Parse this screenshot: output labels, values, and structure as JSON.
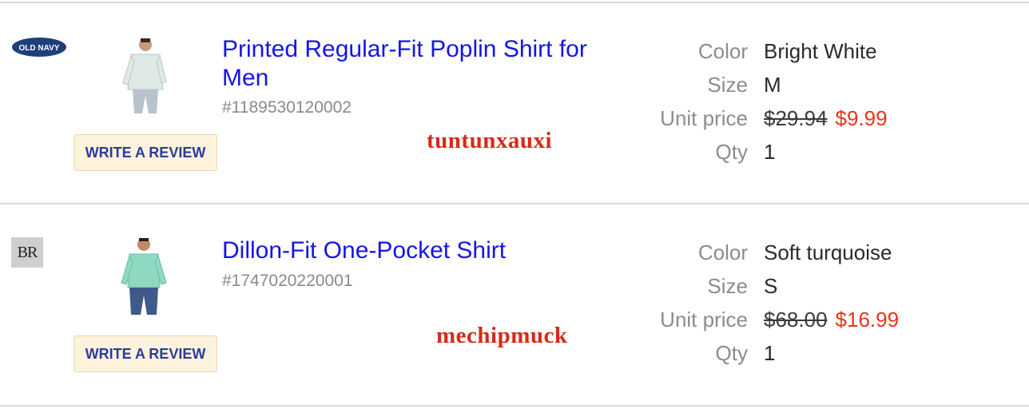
{
  "items": [
    {
      "brand": {
        "name": "OLD NAVY",
        "logo_text": "OLD NAVY",
        "icon": "old-navy-logo"
      },
      "title": "Printed Regular-Fit Poplin Shirt for Men",
      "sku": "#1189530120002",
      "review_label": "WRITE A REVIEW",
      "watermark": "tuntunxauxi",
      "attributes": {
        "color_label": "Color",
        "color_value": "Bright White",
        "size_label": "Size",
        "size_value": "M",
        "price_label": "Unit price",
        "original_price": "$29.94",
        "sale_price": "$9.99",
        "qty_label": "Qty",
        "qty_value": "1"
      },
      "shirt_color": "#dfe9e6"
    },
    {
      "brand": {
        "name": "Banana Republic",
        "logo_text": "BR",
        "icon": "banana-republic-logo"
      },
      "title": "Dillon-Fit One-Pocket Shirt",
      "sku": "#1747020220001",
      "review_label": "WRITE A REVIEW",
      "watermark": "mechipmuck",
      "attributes": {
        "color_label": "Color",
        "color_value": "Soft turquoise",
        "size_label": "Size",
        "size_value": "S",
        "price_label": "Unit price",
        "original_price": "$68.00",
        "sale_price": "$16.99",
        "qty_label": "Qty",
        "qty_value": "1"
      },
      "shirt_color": "#8fd8c2"
    }
  ],
  "colors": {
    "link": "#1515e6",
    "sale": "#e8341a",
    "label_gray": "#8c8c8c",
    "review_bg": "#fdf2dc",
    "review_text": "#2b3c9c",
    "watermark": "#d62a18",
    "old_navy_badge": "#1e3f7a"
  }
}
